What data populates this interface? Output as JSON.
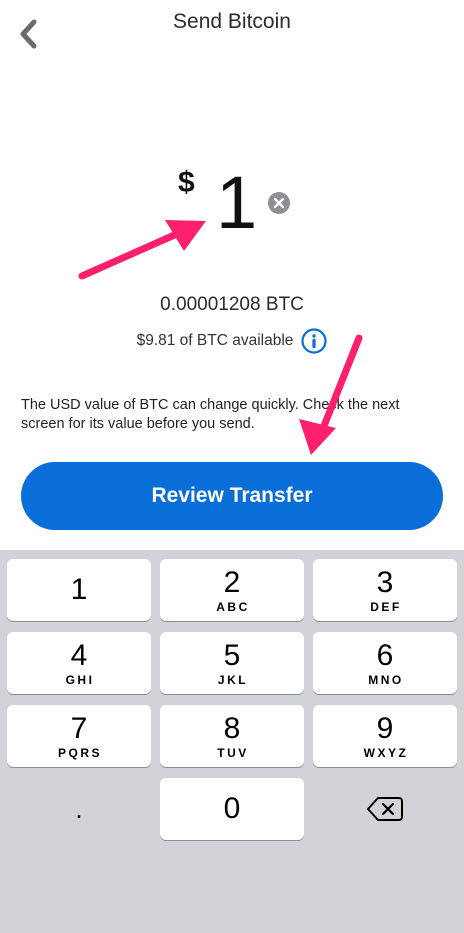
{
  "header": {
    "title": "Send Bitcoin",
    "back_icon": "chevron-left-icon"
  },
  "amount": {
    "currency_symbol": "$",
    "value": "1",
    "clear_icon": "clear-circle-icon"
  },
  "conversion": {
    "btc_amount": "0.00001208 BTC",
    "available": "$9.81 of BTC available",
    "info_icon": "info-circle-icon"
  },
  "note": "The USD value of BTC can change quickly. Check the next screen for its value before you send.",
  "cta": {
    "label": "Review Transfer",
    "color": "#0a6ed8"
  },
  "annotation": {
    "arrow_color": "#ff1f6d"
  },
  "keypad": {
    "keys": [
      {
        "digit": "1",
        "letters": ""
      },
      {
        "digit": "2",
        "letters": "ABC"
      },
      {
        "digit": "3",
        "letters": "DEF"
      },
      {
        "digit": "4",
        "letters": "GHI"
      },
      {
        "digit": "5",
        "letters": "JKL"
      },
      {
        "digit": "6",
        "letters": "MNO"
      },
      {
        "digit": "7",
        "letters": "PQRS"
      },
      {
        "digit": "8",
        "letters": "TUV"
      },
      {
        "digit": "9",
        "letters": "WXYZ"
      },
      {
        "digit": ".",
        "letters": ""
      },
      {
        "digit": "0",
        "letters": ""
      },
      {
        "digit": "",
        "letters": ""
      }
    ],
    "delete_icon": "backspace-icon"
  }
}
